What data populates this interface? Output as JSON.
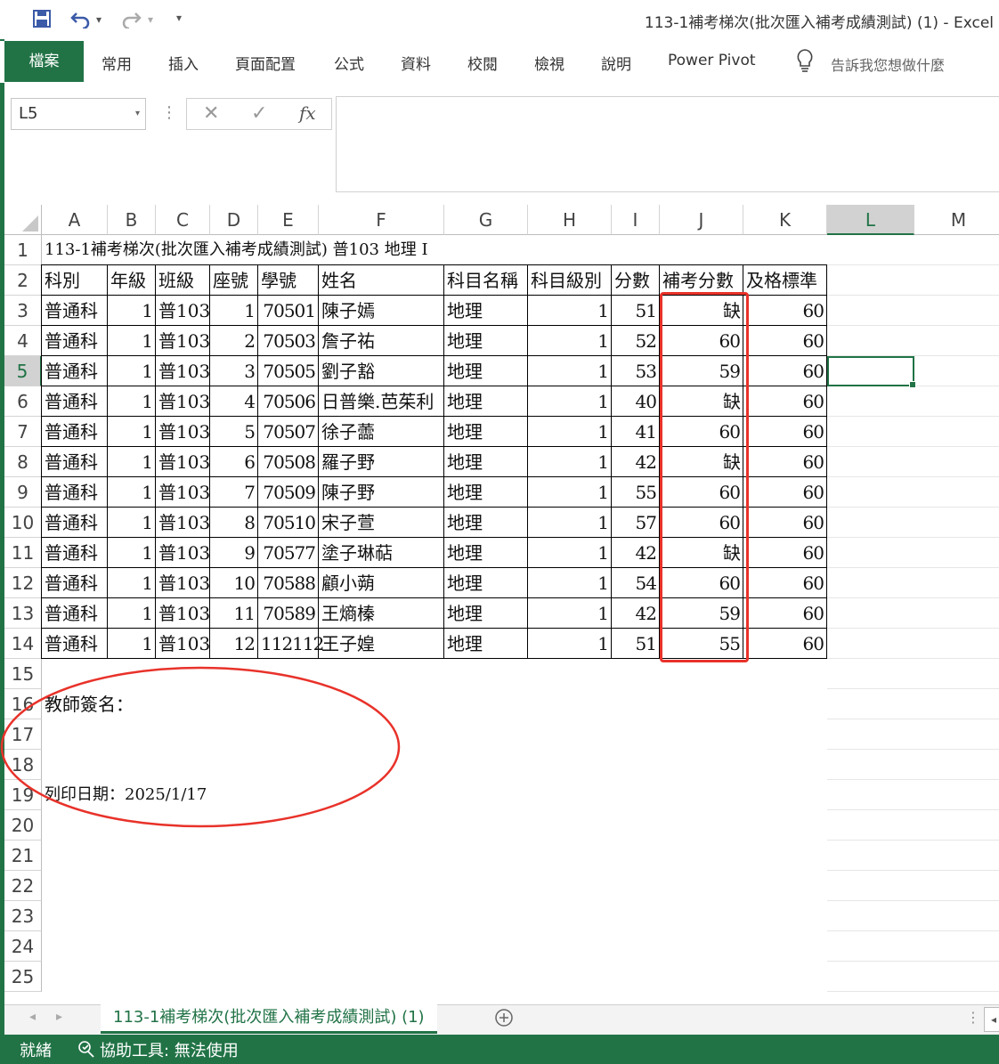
{
  "window": {
    "title": "113-1補考梯次(批次匯入補考成績測試) (1)  -  Excel"
  },
  "ribbon": {
    "tabs": [
      "檔案",
      "常用",
      "插入",
      "頁面配置",
      "公式",
      "資料",
      "校閱",
      "檢視",
      "說明",
      "Power Pivot"
    ],
    "tell_me": "告訴我您想做什麼"
  },
  "formula_bar": {
    "name_box": "L5",
    "formula": "",
    "fx_label": "fx"
  },
  "grid": {
    "columns": [
      "A",
      "B",
      "C",
      "D",
      "E",
      "F",
      "G",
      "H",
      "I",
      "J",
      "K",
      "L",
      "M"
    ],
    "selected_column": "L",
    "rows": [
      "1",
      "2",
      "3",
      "4",
      "5",
      "6",
      "7",
      "8",
      "9",
      "10",
      "11",
      "12",
      "13",
      "14",
      "15",
      "16",
      "17",
      "18",
      "19",
      "20",
      "21",
      "22",
      "23",
      "24",
      "25"
    ],
    "selected_row": "5"
  },
  "sheet": {
    "title": "113-1補考梯次(批次匯入補考成績測試) 普103 地理 I",
    "headers": [
      "科別",
      "年級",
      "班級",
      "座號",
      "學號",
      "姓名",
      "科目名稱",
      "科目級別",
      "分數",
      "補考分數",
      "及格標準"
    ],
    "rows": [
      [
        "普通科",
        "1",
        "普103",
        "1",
        "70501",
        "陳子嫣",
        "地理",
        "1",
        "51",
        "缺",
        "60"
      ],
      [
        "普通科",
        "1",
        "普103",
        "2",
        "70503",
        "詹子祐",
        "地理",
        "1",
        "52",
        "60",
        "60"
      ],
      [
        "普通科",
        "1",
        "普103",
        "3",
        "70505",
        "劉子豁",
        "地理",
        "1",
        "53",
        "59",
        "60"
      ],
      [
        "普通科",
        "1",
        "普103",
        "4",
        "70506",
        "日普樂.芭茱利",
        "地理",
        "1",
        "40",
        "缺",
        "60"
      ],
      [
        "普通科",
        "1",
        "普103",
        "5",
        "70507",
        "徐子蘦",
        "地理",
        "1",
        "41",
        "60",
        "60"
      ],
      [
        "普通科",
        "1",
        "普103",
        "6",
        "70508",
        "羅子野",
        "地理",
        "1",
        "42",
        "缺",
        "60"
      ],
      [
        "普通科",
        "1",
        "普103",
        "7",
        "70509",
        "陳子野",
        "地理",
        "1",
        "55",
        "60",
        "60"
      ],
      [
        "普通科",
        "1",
        "普103",
        "8",
        "70510",
        "宋子萱",
        "地理",
        "1",
        "57",
        "60",
        "60"
      ],
      [
        "普通科",
        "1",
        "普103",
        "9",
        "70577",
        "塗子琳萜",
        "地理",
        "1",
        "42",
        "缺",
        "60"
      ],
      [
        "普通科",
        "1",
        "普103",
        "10",
        "70588",
        "顧小蒴",
        "地理",
        "1",
        "54",
        "60",
        "60"
      ],
      [
        "普通科",
        "1",
        "普103",
        "11",
        "70589",
        "王熵榛",
        "地理",
        "1",
        "42",
        "59",
        "60"
      ],
      [
        "普通科",
        "1",
        "普103",
        "12",
        "112112",
        "王子媓",
        "地理",
        "1",
        "51",
        "55",
        "60"
      ]
    ],
    "teacher_sign": "教師簽名：",
    "print_date": "列印日期：2025/1/17"
  },
  "sheet_tabs": {
    "active": "113-1補考梯次(批次匯入補考成績測試) (1)"
  },
  "status": {
    "ready": "就緒",
    "accessibility": "協助工具: 無法使用"
  },
  "colors": {
    "excel_green": "#217346",
    "annotation_red": "#e8322a"
  }
}
